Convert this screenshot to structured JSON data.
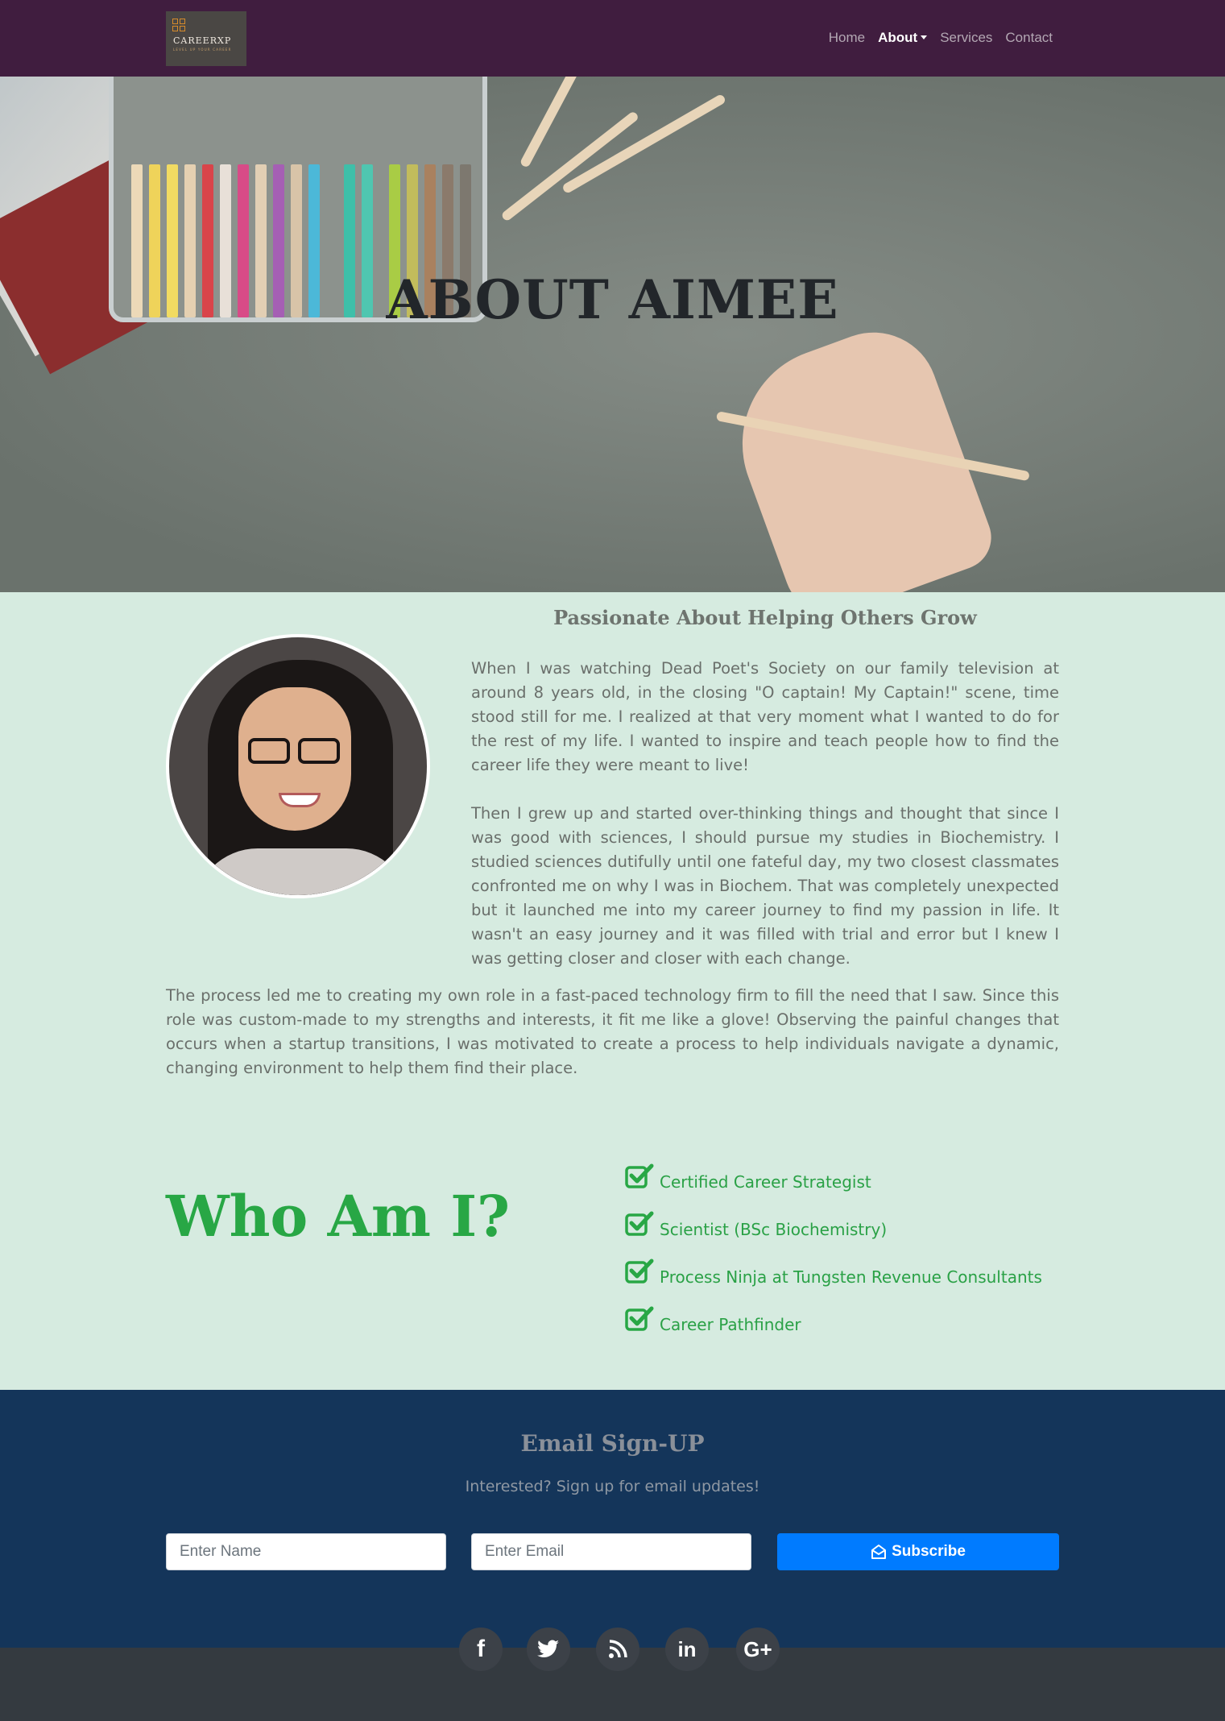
{
  "brand": {
    "name": "CAREERXP",
    "tagline": "LEVEL UP YOUR CAREER",
    "accent": "#d78b2b"
  },
  "nav": {
    "items": [
      {
        "label": "Home",
        "active": false
      },
      {
        "label": "About",
        "active": true,
        "dropdown": true
      },
      {
        "label": "Services",
        "active": false
      },
      {
        "label": "Contact",
        "active": false
      }
    ]
  },
  "hero": {
    "title": "ABOUT AIMEE"
  },
  "about": {
    "heading": "Passionate About Helping Others Grow",
    "paragraphs": [
      "When I was watching Dead Poet's Society on our family television at around 8 years old, in the closing \"O captain! My Captain!\" scene, time stood still for me. I realized at that very moment what I wanted to do for the rest of my life. I wanted to inspire and teach people how to find the career life they were meant to live!",
      "Then I grew up and started over-thinking things and thought that since I was good with sciences, I should pursue my studies in Biochemistry. I studied sciences dutifully until one fateful day, my two closest classmates confronted me on why I was in Biochem. That was completely unexpected but it launched me into my career journey to find my passion in life. It wasn't an easy journey and it was filled with trial and error but I knew I was getting closer and closer with each change.",
      "The process led me to creating my own role in a fast-paced technology firm to fill the need that I saw. Since this role was custom-made to my strengths and interests, it fit me like a glove! Observing the painful changes that occurs when a startup transitions, I was motivated to create a process to help individuals navigate a dynamic, changing environment to help them find their place."
    ]
  },
  "who": {
    "title": "Who Am I?",
    "credentials": [
      "Certified Career Strategist",
      "Scientist (BSc Biochemistry)",
      "Process Ninja at Tungsten Revenue Consultants",
      "Career Pathfinder"
    ],
    "color": "#28a745"
  },
  "signup": {
    "title": "Email Sign-UP",
    "subtitle": "Interested? Sign up for email updates!",
    "name_placeholder": "Enter Name",
    "email_placeholder": "Enter Email",
    "button_label": "Subscribe",
    "button_color": "#007bff"
  },
  "social": {
    "icons": [
      {
        "name": "facebook-icon",
        "glyph": "f"
      },
      {
        "name": "twitter-icon",
        "glyph": "🐦"
      },
      {
        "name": "rss-icon",
        "glyph": "rss"
      },
      {
        "name": "linkedin-icon",
        "glyph": "in"
      },
      {
        "name": "google-plus-icon",
        "glyph": "G+"
      }
    ]
  }
}
